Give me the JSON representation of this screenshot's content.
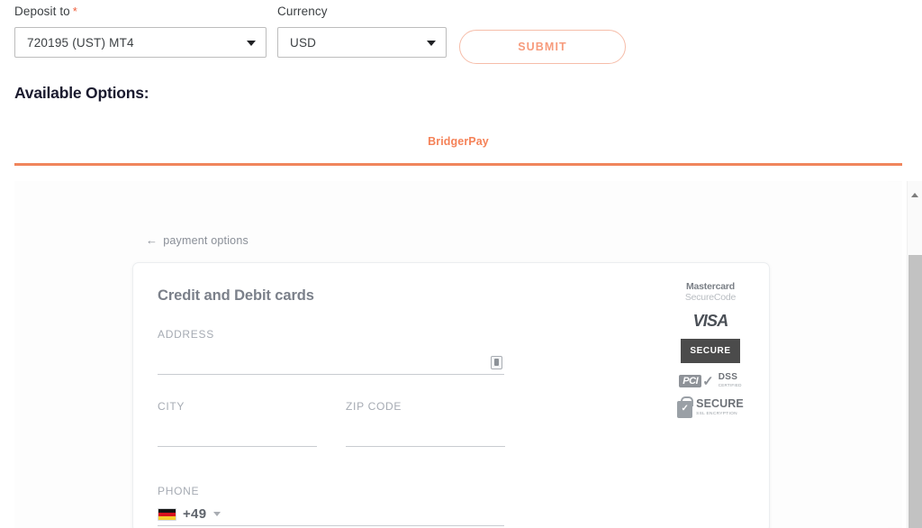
{
  "form": {
    "deposit": {
      "label": "Deposit to",
      "required_mark": "*",
      "value": "720195 (UST) MT4"
    },
    "currency": {
      "label": "Currency",
      "value": "USD"
    },
    "submit_label": "SUBMIT"
  },
  "available_options": {
    "title": "Available Options:",
    "tabs": [
      {
        "label": "BridgerPay",
        "active": true
      }
    ]
  },
  "payment_widget": {
    "back_link": {
      "arrow": "←",
      "label": "payment options"
    },
    "card_title": "Credit and Debit cards",
    "fields": {
      "address": {
        "label": "ADDRESS",
        "value": "",
        "icon": "address-book-icon"
      },
      "city": {
        "label": "CITY",
        "value": ""
      },
      "zip": {
        "label": "ZIP CODE",
        "value": ""
      },
      "phone": {
        "label": "PHONE",
        "country_flag": "germany-flag",
        "dial_code": "+49",
        "value": ""
      }
    },
    "badges": [
      {
        "name": "mastercard-securecode-badge",
        "line1": "Mastercard",
        "line2": "SecureCode"
      },
      {
        "name": "visa-badge",
        "text": "VISA"
      },
      {
        "name": "secure-badge",
        "text": "SECURE"
      },
      {
        "name": "pci-dss-badge",
        "mark": "PCI",
        "check": "✓",
        "line1": "DSS",
        "line2": "CERTIFIED"
      },
      {
        "name": "ssl-secure-badge",
        "lock": "✓",
        "line1": "SECURE",
        "line2": "SSL ENCRYPTION"
      }
    ]
  },
  "colors": {
    "accent_orange": "#f0855c",
    "tab_text": "#f58258",
    "submit_border": "#f6bda9",
    "submit_text": "#f79b7c",
    "required_asterisk": "#ef5f3c"
  },
  "scrollbar": {
    "up_arrow": "▲"
  }
}
